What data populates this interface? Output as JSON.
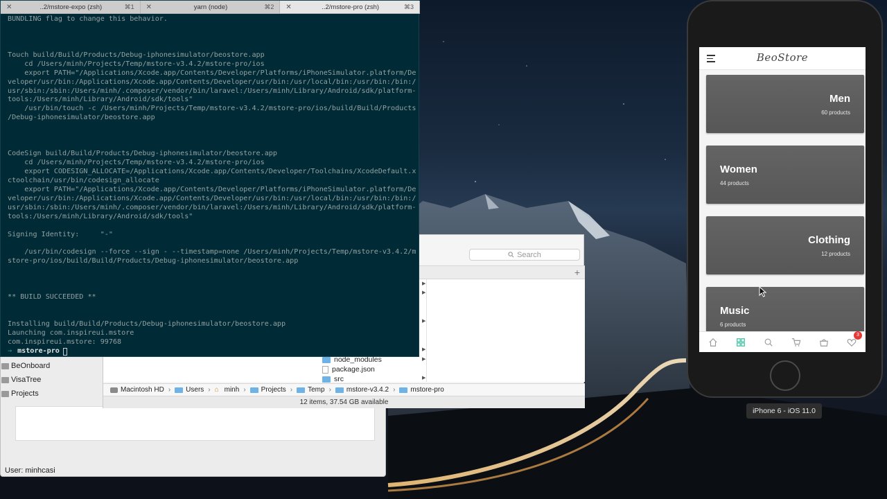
{
  "terminal": {
    "tabs": [
      {
        "title": "..2/mstore-expo (zsh)",
        "shortcut": "⌘1"
      },
      {
        "title": "yarn (node)",
        "shortcut": "⌘2"
      },
      {
        "title": "..2/mstore-pro (zsh)",
        "shortcut": "⌘3"
      }
    ],
    "lines": [
      "BUNDLING flag to change this behavior.",
      "",
      "",
      "",
      "Touch build/Build/Products/Debug-iphonesimulator/beostore.app",
      "    cd /Users/minh/Projects/Temp/mstore-v3.4.2/mstore-pro/ios",
      "    export PATH=\"/Applications/Xcode.app/Contents/Developer/Platforms/iPhoneSimulator.platform/De",
      "veloper/usr/bin:/Applications/Xcode.app/Contents/Developer/usr/bin:/usr/local/bin:/usr/bin:/bin:/",
      "usr/sbin:/sbin:/Users/minh/.composer/vendor/bin/laravel:/Users/minh/Library/Android/sdk/platform-",
      "tools:/Users/minh/Library/Android/sdk/tools\"",
      "    /usr/bin/touch -c /Users/minh/Projects/Temp/mstore-v3.4.2/mstore-pro/ios/build/Build/Products",
      "/Debug-iphonesimulator/beostore.app",
      "",
      "",
      "",
      "CodeSign build/Build/Products/Debug-iphonesimulator/beostore.app",
      "    cd /Users/minh/Projects/Temp/mstore-v3.4.2/mstore-pro/ios",
      "    export CODESIGN_ALLOCATE=/Applications/Xcode.app/Contents/Developer/Toolchains/XcodeDefault.x",
      "ctoolchain/usr/bin/codesign_allocate",
      "    export PATH=\"/Applications/Xcode.app/Contents/Developer/Platforms/iPhoneSimulator.platform/De",
      "veloper/usr/bin:/Applications/Xcode.app/Contents/Developer/usr/bin:/usr/local/bin:/usr/bin:/bin:/",
      "usr/sbin:/sbin:/Users/minh/.composer/vendor/bin/laravel:/Users/minh/Library/Android/sdk/platform-",
      "tools:/Users/minh/Library/Android/sdk/tools\"",
      "",
      "Signing Identity:     \"-\"",
      "",
      "    /usr/bin/codesign --force --sign - --timestamp=none /Users/minh/Projects/Temp/mstore-v3.4.2/m",
      "store-pro/ios/build/Build/Products/Debug-iphonesimulator/beostore.app",
      "",
      "",
      "",
      "** BUILD SUCCEEDED **",
      "",
      "",
      "Installing build/Build/Products/Debug-iphonesimulator/beostore.app",
      "Launching com.inspireui.mstore",
      "com.inspireui.mstore: 99768"
    ],
    "prompt": {
      "arrow": "→",
      "dir": "mstore-pro"
    }
  },
  "finder": {
    "search_placeholder": "Search",
    "files": [
      {
        "name": "node_modules",
        "type": "folder"
      },
      {
        "name": "package.json",
        "type": "file"
      },
      {
        "name": "src",
        "type": "folder"
      }
    ],
    "path": [
      "Macintosh HD",
      "Users",
      "minh",
      "Projects",
      "Temp",
      "mstore-v3.4.2",
      "mstore-pro"
    ],
    "status": "12 items, 37.54 GB available"
  },
  "sidebar": {
    "items": [
      "BeOnboard",
      "VisaTree",
      "Projects"
    ]
  },
  "back_window": {
    "user_line": "User: minhcasi"
  },
  "simulator": {
    "label": "iPhone 6 - iOS 11.0",
    "app": {
      "brand": "BeoStore",
      "categories": [
        {
          "name": "Men",
          "count": "60 products",
          "align": "right"
        },
        {
          "name": "Women",
          "count": "44 products",
          "align": "left"
        },
        {
          "name": "Clothing",
          "count": "12 products",
          "align": "right"
        },
        {
          "name": "Music",
          "count": "6 products",
          "align": "left"
        }
      ],
      "nav": [
        {
          "icon": "home-icon",
          "active": false
        },
        {
          "icon": "grid-icon",
          "active": true
        },
        {
          "icon": "search-icon",
          "active": false
        },
        {
          "icon": "cart-icon",
          "active": false
        },
        {
          "icon": "bag-icon",
          "active": false
        },
        {
          "icon": "heart-icon",
          "active": false,
          "badge": "3"
        }
      ],
      "accent": "#3bbfa0"
    }
  }
}
